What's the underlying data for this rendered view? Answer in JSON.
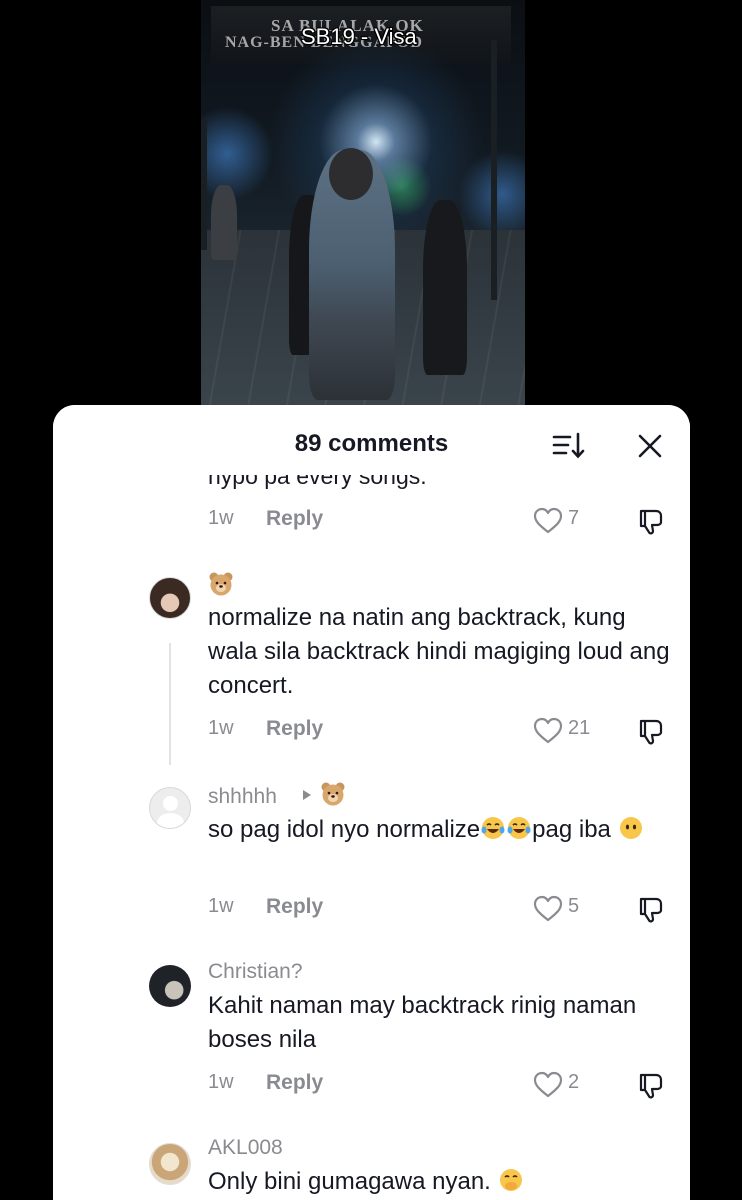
{
  "video": {
    "title": "SB19 - Visa",
    "sign_line_1": "SA BULALAK OK",
    "sign_line_2": "NAG-BEN   BENGGAPOD"
  },
  "sheet": {
    "title": "89 comments",
    "sort_icon": "sort-icon",
    "close_icon": "close-icon"
  },
  "comments": [
    {
      "text": "nypo pa every songs.",
      "time": "1w",
      "reply_label": "Reply",
      "likes": "7"
    },
    {
      "username_emoji": "bear-face",
      "text": "normalize na natin ang backtrack, kung wala sila backtrack hindi magiging loud ang concert.",
      "time": "1w",
      "reply_label": "Reply",
      "likes": "21"
    },
    {
      "username": "shhhhh",
      "reply_to_emoji": "bear-face",
      "text_part_1": "so pag idol nyo normalize",
      "text_part_2": "pag iba",
      "time": "1w",
      "reply_label": "Reply",
      "likes": "5"
    },
    {
      "username": "Christian?",
      "text": "Kahit naman may backtrack rinig naman boses nila",
      "time": "1w",
      "reply_label": "Reply",
      "likes": "2"
    },
    {
      "username": "AKL008",
      "text": "Only bini gumagawa nyan."
    }
  ],
  "colors": {
    "text_primary": "#161823",
    "text_secondary": "#8a8b91",
    "sheet_bg": "#ffffff",
    "page_bg": "#000000"
  }
}
